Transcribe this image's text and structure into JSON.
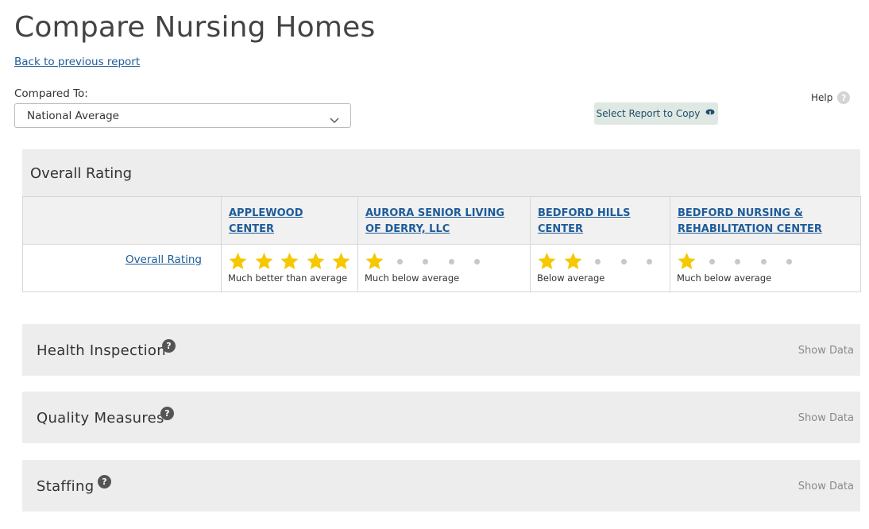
{
  "page": {
    "title": "Compare Nursing Homes",
    "back_link": "Back to previous report"
  },
  "compare": {
    "label": "Compared To:",
    "selected": "National Average"
  },
  "copy_button": {
    "label": "Select Report to Copy",
    "icon": "copy-icon"
  },
  "help": {
    "label": "Help",
    "icon": "question-icon"
  },
  "overall": {
    "title": "Overall Rating",
    "row_label": "Overall Rating",
    "star_color": "#f5c800",
    "facilities": [
      {
        "name": "APPLEWOOD CENTER",
        "stars": 5,
        "max": 5,
        "text": "Much better than average"
      },
      {
        "name": "AURORA SENIOR LIVING OF DERRY, LLC",
        "stars": 1,
        "max": 5,
        "text": "Much below average"
      },
      {
        "name": "BEDFORD HILLS CENTER",
        "stars": 2,
        "max": 5,
        "text": "Below average"
      },
      {
        "name": "BEDFORD NURSING & REHABILITATION CENTER",
        "stars": 1,
        "max": 5,
        "text": "Much below average"
      }
    ]
  },
  "sections": [
    {
      "title": "Health Inspection",
      "action": "Show Data"
    },
    {
      "title": "Quality Measures",
      "action": "Show Data"
    },
    {
      "title": "Staffing",
      "action": "Show Data"
    }
  ]
}
